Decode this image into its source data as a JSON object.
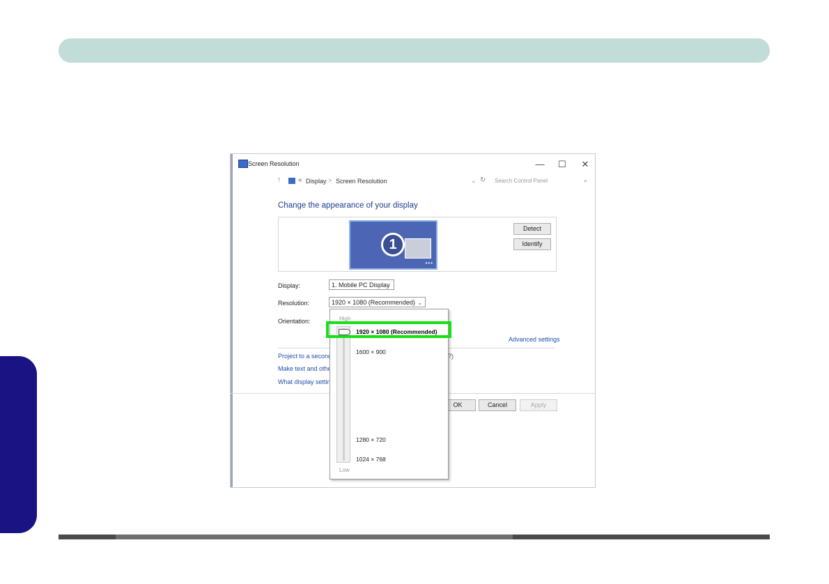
{
  "window": {
    "title": "Screen Resolution",
    "minimize_glyph": "—",
    "maximize_glyph": "☐",
    "close_glyph": "✕"
  },
  "navbar": {
    "up_glyph": "↑",
    "chevron_glyph": "«",
    "breadcrumb": [
      "Display",
      "Screen Resolution"
    ],
    "separator": ">",
    "dropdown_glyph": "⌄",
    "refresh_glyph": "↻",
    "search_placeholder": "Search Control Panel",
    "search_glyph": "⌕"
  },
  "main": {
    "heading": "Change the appearance of your display",
    "monitor_number": "1",
    "monitor_dots": "•••",
    "detect_label": "Detect",
    "identify_label": "Identify",
    "display_label": "Display:",
    "display_value": "1. Mobile PC Display",
    "resolution_label": "Resolution:",
    "resolution_value": "1920 × 1080 (Recommended)",
    "orientation_label": "Orientation:",
    "advanced_settings": "Advanced settings",
    "link_project": "Project to a second",
    "link_text_size": "Make text and other",
    "link_display_settings": "What display setting",
    "partial_paren": "?)",
    "ok_label": "OK",
    "cancel_label": "Cancel",
    "apply_label": "Apply"
  },
  "dropdown": {
    "high_label": "High",
    "low_label": "Low",
    "options": [
      "1920 × 1080 (Recommended)",
      "1600 × 900",
      "1280 × 720",
      "1024 × 768"
    ],
    "selected_index": 0
  },
  "icons": {
    "window_icon": "screen-resolution-icon",
    "display_icon": "display-control-panel-icon"
  },
  "colors": {
    "highlight": "#14e014",
    "heading": "#1e3f8c",
    "link": "#1e4fa8",
    "top_band": "#c2ddd8",
    "side_tab": "#1a1383"
  }
}
